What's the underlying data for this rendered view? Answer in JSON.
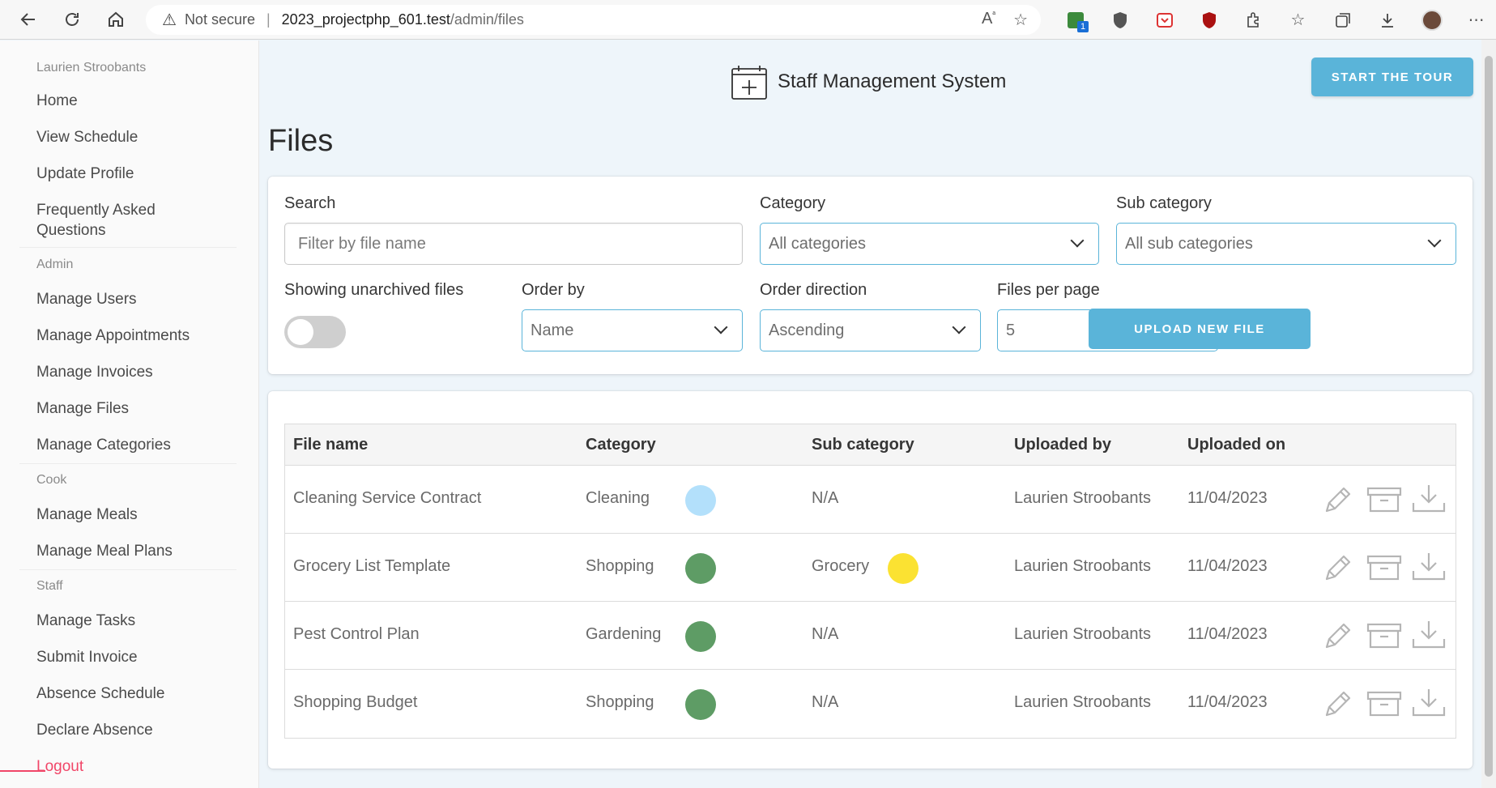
{
  "browser": {
    "security": "Not secure",
    "url_host": "2023_projectphp_601.test",
    "url_path": "/admin/files",
    "ext_badge": "1"
  },
  "sidebar": {
    "user": "Laurien Stroobants",
    "main_links": [
      "Home",
      "View Schedule",
      "Update Profile",
      "Frequently Asked Questions"
    ],
    "admin_label": "Admin",
    "admin_links": [
      "Manage Users",
      "Manage Appointments",
      "Manage Invoices",
      "Manage Files",
      "Manage Categories"
    ],
    "cook_label": "Cook",
    "cook_links": [
      "Manage Meals",
      "Manage Meal Plans"
    ],
    "staff_label": "Staff",
    "staff_links": [
      "Manage Tasks",
      "Submit Invoice",
      "Absence Schedule",
      "Declare Absence"
    ],
    "logout": "Logout"
  },
  "header": {
    "brand": "Staff Management System",
    "tour_button": "START THE TOUR"
  },
  "page_title": "Files",
  "filters": {
    "search_label": "Search",
    "search_placeholder": "Filter by file name",
    "category_label": "Category",
    "category_value": "All categories",
    "subcategory_label": "Sub category",
    "subcategory_value": "All sub categories",
    "archived_label": "Showing unarchived files",
    "archived_on": false,
    "order_by_label": "Order by",
    "order_by_value": "Name",
    "order_dir_label": "Order direction",
    "order_dir_value": "Ascending",
    "per_page_label": "Files per page",
    "per_page_value": "5",
    "upload_button": "UPLOAD NEW FILE"
  },
  "table": {
    "headers": [
      "File name",
      "Category",
      "Sub category",
      "Uploaded by",
      "Uploaded on"
    ],
    "rows": [
      {
        "name": "Cleaning Service Contract",
        "category": "Cleaning",
        "category_color": "#b3e0fb",
        "subcategory": "N/A",
        "subcategory_color": "",
        "uploaded_by": "Laurien Stroobants",
        "uploaded_on": "11/04/2023"
      },
      {
        "name": "Grocery List Template",
        "category": "Shopping",
        "category_color": "#5e9c65",
        "subcategory": "Grocery",
        "subcategory_color": "#fbe232",
        "uploaded_by": "Laurien Stroobants",
        "uploaded_on": "11/04/2023"
      },
      {
        "name": "Pest Control Plan",
        "category": "Gardening",
        "category_color": "#5e9c65",
        "subcategory": "N/A",
        "subcategory_color": "",
        "uploaded_by": "Laurien Stroobants",
        "uploaded_on": "11/04/2023"
      },
      {
        "name": "Shopping Budget",
        "category": "Shopping",
        "category_color": "#5e9c65",
        "subcategory": "N/A",
        "subcategory_color": "",
        "uploaded_by": "Laurien Stroobants",
        "uploaded_on": "11/04/2023"
      }
    ],
    "action_icons": [
      "edit-icon",
      "archive-icon",
      "download-icon"
    ]
  },
  "colors": {
    "accent": "#5ab4d9",
    "danger": "#f14668"
  }
}
